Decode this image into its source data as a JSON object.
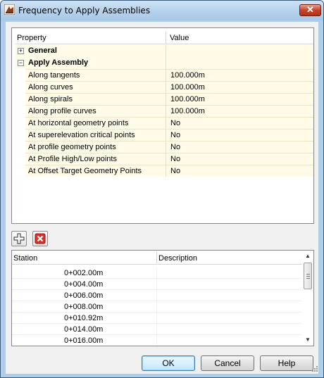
{
  "window": {
    "title": "Frequency to Apply Assemblies",
    "close_label": "✕"
  },
  "properties": {
    "header": {
      "property": "Property",
      "value": "Value"
    },
    "groups": [
      {
        "label": "General",
        "expander": "+"
      },
      {
        "label": "Apply Assembly",
        "expander": "−"
      }
    ],
    "rows": [
      {
        "name": "Along tangents",
        "value": "100.000m"
      },
      {
        "name": "Along curves",
        "value": "100.000m"
      },
      {
        "name": "Along spirals",
        "value": "100.000m"
      },
      {
        "name": "Along profile curves",
        "value": "100.000m"
      },
      {
        "name": "At horizontal geometry points",
        "value": "No"
      },
      {
        "name": "At superelevation critical points",
        "value": "No"
      },
      {
        "name": "At profile geometry points",
        "value": "No"
      },
      {
        "name": "At Profile High/Low points",
        "value": "No"
      },
      {
        "name": "At Offset Target Geometry Points",
        "value": "No"
      }
    ]
  },
  "toolbar": {
    "add_icon": "add-icon",
    "delete_icon": "delete-icon"
  },
  "stations": {
    "header": {
      "station": "Station",
      "description": "Description"
    },
    "rows": [
      {
        "station": "0+002.00m",
        "description": ""
      },
      {
        "station": "0+004.00m",
        "description": ""
      },
      {
        "station": "0+006.00m",
        "description": ""
      },
      {
        "station": "0+008.00m",
        "description": ""
      },
      {
        "station": "0+010.92m",
        "description": ""
      },
      {
        "station": "0+014.00m",
        "description": ""
      },
      {
        "station": "0+016.00m",
        "description": ""
      }
    ]
  },
  "buttons": {
    "ok": "OK",
    "cancel": "Cancel",
    "help": "Help"
  },
  "colors": {
    "title_bar": "#b5d1ec",
    "close_button": "#c8432a",
    "value_cell": "#fffbe8"
  }
}
